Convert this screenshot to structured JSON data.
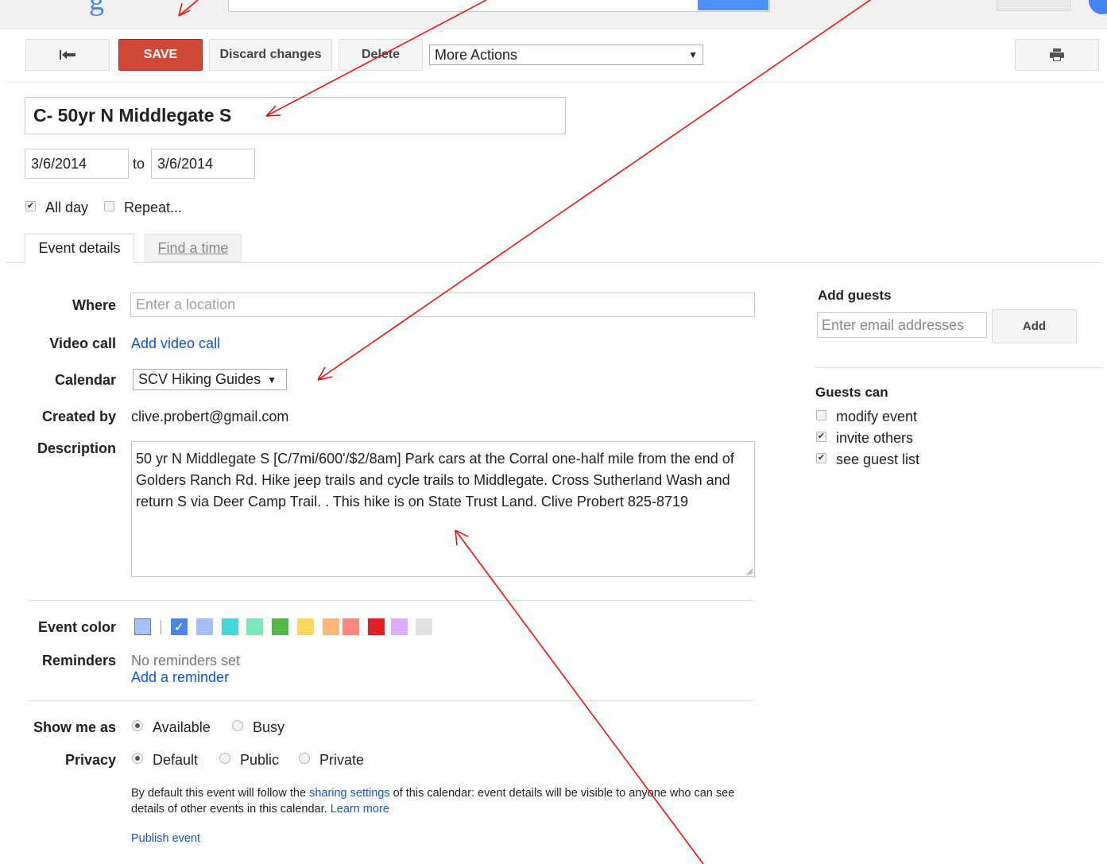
{
  "toolbar": {
    "save": "SAVE",
    "discard": "Discard changes",
    "delete": "Delete",
    "more_actions": "More Actions",
    "back_icon": "back-arrow-icon",
    "print_icon": "printer-icon"
  },
  "event": {
    "title": "C- 50yr N Middlegate S",
    "start_date": "3/6/2014",
    "to": "to",
    "end_date": "3/6/2014",
    "all_day_label": "All day",
    "all_day_checked": true,
    "repeat_label": "Repeat...",
    "repeat_checked": false
  },
  "tabs": {
    "event_details": "Event details",
    "find_a_time": "Find a time"
  },
  "details": {
    "where_label": "Where",
    "where_placeholder": "Enter a location",
    "video_label": "Video call",
    "video_link": "Add video call",
    "calendar_label": "Calendar",
    "calendar_value": "SCV Hiking Guides",
    "created_by_label": "Created by",
    "created_by_value": "clive.probert@gmail.com",
    "description_label": "Description",
    "description_value": "50 yr N Middlegate S [C/7mi/600'/$2/8am]  Park cars at the Corral one-half mile from the end of Golders Ranch Rd. Hike  jeep trails and cycle trails to Middlegate. Cross Sutherland Wash and return S via Deer Camp Trail. . This hike is on State Trust Land. Clive Probert 825-8719",
    "event_color_label": "Event color",
    "event_colors": [
      "#a4c2f4",
      "#4986e7",
      "#a4bdfc",
      "#46d6db",
      "#7ae7bf",
      "#51b749",
      "#fbd75b",
      "#ffb878",
      "#ff887c",
      "#dc2127",
      "#dbadff",
      "#e1e1e1"
    ],
    "reminders_label": "Reminders",
    "reminders_none": "No reminders set",
    "add_reminder": "Add a reminder",
    "show_me_as_label": "Show me as",
    "available": "Available",
    "busy": "Busy",
    "privacy_label": "Privacy",
    "privacy_default": "Default",
    "privacy_public": "Public",
    "privacy_private": "Private",
    "privacy_note_pre": "By default this event will follow the ",
    "privacy_note_link": "sharing settings",
    "privacy_note_mid": " of this calendar: event details will be visible to anyone who can see details of other events in this calendar.  ",
    "learn_more": "Learn more",
    "publish_event": "Publish event"
  },
  "guests": {
    "title": "Add guests",
    "input_placeholder": "Enter email addresses",
    "add_button": "Add",
    "guests_can_title": "Guests can",
    "modify_event": "modify event",
    "modify_checked": false,
    "invite_others": "invite others",
    "invite_checked": true,
    "see_guest_list": "see guest list",
    "see_checked": true
  },
  "annotation_color": "#ff0000"
}
